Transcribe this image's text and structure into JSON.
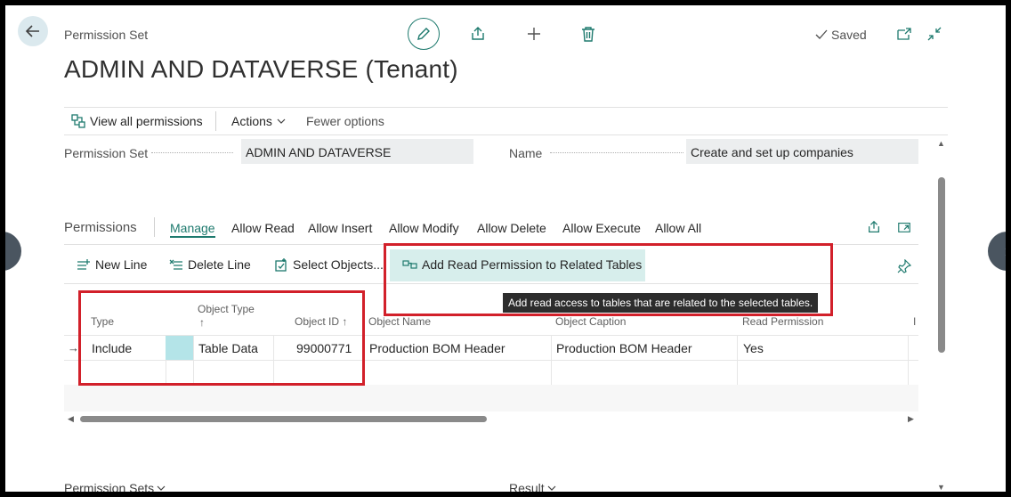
{
  "header": {
    "breadcrumb": "Permission Set",
    "title": "ADMIN AND DATAVERSE (Tenant)",
    "saved": "Saved"
  },
  "actionbar": {
    "view_all": "View all permissions",
    "actions": "Actions",
    "fewer_options": "Fewer options"
  },
  "fields": {
    "permission_set_label": "Permission Set",
    "permission_set_value": "ADMIN AND DATAVERSE",
    "name_label": "Name",
    "name_value": "Create and set up companies"
  },
  "permissions": {
    "title": "Permissions",
    "tabs": [
      "Manage",
      "Allow Read",
      "Allow Insert",
      "Allow Modify",
      "Allow Delete",
      "Allow Execute",
      "Allow All"
    ],
    "toolbar": {
      "new_line": "New Line",
      "delete_line": "Delete Line",
      "select_objects": "Select Objects...",
      "add_read": "Add Read Permission to Related Tables"
    },
    "tooltip": "Add read access to tables that are related to the selected tables.",
    "columns": {
      "type": "Type",
      "object_type": "Object Type",
      "sort_arrow": "↑",
      "object_id": "Object ID ↑",
      "object_name": "Object Name",
      "object_caption": "Object Caption",
      "read_permission": "Read Permission",
      "next": "I"
    },
    "rows": [
      {
        "type": "Include",
        "object_type": "Table Data",
        "object_id": "99000771",
        "object_name": "Production BOM Header",
        "object_caption": "Production BOM Header",
        "read_permission": "Yes"
      }
    ]
  },
  "bottom": {
    "permission_sets": "Permission Sets",
    "result": "Result"
  },
  "colors": {
    "accent": "#1e7a6e",
    "annotation_red": "#d2202a",
    "highlight": "#d7eeec"
  }
}
